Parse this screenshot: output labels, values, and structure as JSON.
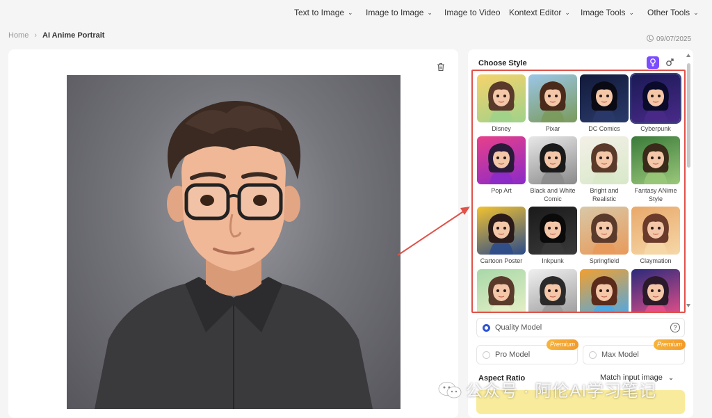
{
  "nav": {
    "items": [
      {
        "label": "Text to Image",
        "has_menu": true
      },
      {
        "label": "Image to Image",
        "has_menu": true
      },
      {
        "label": "Image to Video",
        "has_menu": false
      },
      {
        "label": "Kontext Editor",
        "has_menu": true
      },
      {
        "label": "Image Tools",
        "has_menu": true
      },
      {
        "label": "Other Tools",
        "has_menu": true
      }
    ]
  },
  "breadcrumb": {
    "home": "Home",
    "current": "AI Anime Portrait"
  },
  "date": "09/07/2025",
  "style_panel": {
    "title": "Choose Style",
    "styles": [
      {
        "label": "Disney",
        "icon": "disney-style-thumbnail"
      },
      {
        "label": "Pixar",
        "icon": "pixar-style-thumbnail"
      },
      {
        "label": "DC Comics",
        "icon": "dc-comics-style-thumbnail"
      },
      {
        "label": "Cyberpunk",
        "icon": "cyberpunk-style-thumbnail",
        "selected": true
      },
      {
        "label": "Pop Art",
        "icon": "pop-art-style-thumbnail"
      },
      {
        "label": "Black and White Comic",
        "icon": "bw-comic-style-thumbnail"
      },
      {
        "label": "Bright and Realistic",
        "icon": "bright-realistic-style-thumbnail"
      },
      {
        "label": "Fantasy ANime Style",
        "icon": "fantasy-anime-style-thumbnail"
      },
      {
        "label": "Cartoon Poster",
        "icon": "cartoon-poster-style-thumbnail"
      },
      {
        "label": "Inkpunk",
        "icon": "inkpunk-style-thumbnail"
      },
      {
        "label": "Springfield",
        "icon": "springfield-style-thumbnail"
      },
      {
        "label": "Claymation",
        "icon": "claymation-style-thumbnail"
      },
      {
        "label": "",
        "icon": "style-thumbnail-13"
      },
      {
        "label": "",
        "icon": "style-thumbnail-14"
      },
      {
        "label": "",
        "icon": "style-thumbnail-15"
      },
      {
        "label": "",
        "icon": "style-thumbnail-16"
      }
    ]
  },
  "models": {
    "quality": "Quality Model",
    "pro": "Pro Model",
    "max": "Max Model",
    "premium_badge": "Premium",
    "help": "?"
  },
  "aspect_ratio": {
    "label": "Aspect Ratio",
    "value": "Match input image"
  },
  "watermark": "公众号 · 阿伦AI学习笔记",
  "colors": {
    "accent_purple": "#7b4dff",
    "radio_blue": "#2f55d4",
    "annotation_red": "#e0524a",
    "premium_orange": "#f39a2a",
    "generate_yellow": "#f9eb9c"
  }
}
